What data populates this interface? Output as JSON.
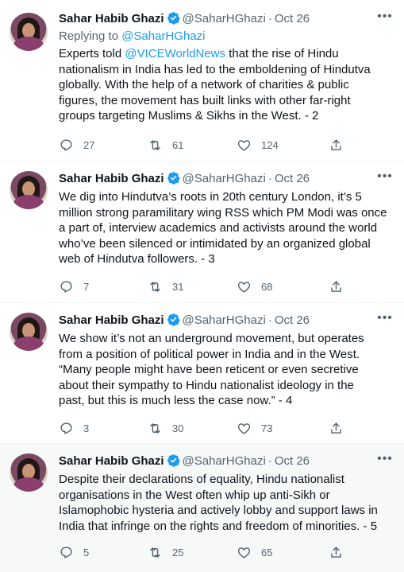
{
  "tweets": [
    {
      "name": "Sahar Habib Ghazi",
      "handle": "@SaharHGhazi",
      "separator": "·",
      "date": "Oct 26",
      "replying_label": "Replying to",
      "replying_handle": "@SaharHGhazi",
      "lines": [
        [
          "Experts told ",
          "@VICEWorldNews",
          " that the rise of Hindu"
        ],
        [
          "nationalism in India has led to the emboldening of Hindutva"
        ],
        [
          "globally. With the help of a network of charities & public"
        ],
        [
          "figures, the movement has built links with other far-right"
        ],
        [
          "groups targeting Muslims & Sikhs in the West. - 2"
        ]
      ],
      "replies": "27",
      "retweets": "61",
      "likes": "124"
    },
    {
      "name": "Sahar Habib Ghazi",
      "handle": "@SaharHGhazi",
      "separator": "·",
      "date": "Oct 26",
      "lines": [
        [
          "We dig into Hindutva’s roots in  20th century London, it’s 5"
        ],
        [
          "million strong paramilitary wing RSS which PM Modi was once"
        ],
        [
          "a part of, interview academics and activists around the world"
        ],
        [
          "who’ve been silenced or intimidated by an organized global"
        ],
        [
          "web of Hindutva followers. - 3"
        ]
      ],
      "replies": "7",
      "retweets": "31",
      "likes": "68"
    },
    {
      "name": "Sahar Habib Ghazi",
      "handle": "@SaharHGhazi",
      "separator": "·",
      "date": "Oct 26",
      "lines": [
        [
          "We show it’s not an underground movement, but operates"
        ],
        [
          "from a position of political power in India and in the West."
        ],
        [
          "“Many people might have been reticent or even secretive"
        ],
        [
          "about their sympathy to Hindu nationalist ideology in the"
        ],
        [
          "past, but this is much less the case now.” - 4"
        ]
      ],
      "replies": "3",
      "retweets": "30",
      "likes": "73"
    },
    {
      "name": "Sahar Habib Ghazi",
      "handle": "@SaharHGhazi",
      "separator": "·",
      "date": "Oct 26",
      "lines": [
        [
          "Despite their declarations of equality, Hindu nationalist"
        ],
        [
          "organisations in the West often whip up anti-Sikh or"
        ],
        [
          "Islamophobic hysteria and actively lobby and support laws in"
        ],
        [
          "India that infringe on the rights and freedom of minorities. - 5"
        ]
      ],
      "replies": "5",
      "retweets": "25",
      "likes": "65"
    }
  ],
  "colors": {
    "link": "#1d9bf0",
    "muted": "#536471",
    "text": "#0f1419",
    "highlight_bg": "#f7f9f9"
  },
  "icons": [
    "verified-badge-icon",
    "more-icon",
    "reply-icon",
    "retweet-icon",
    "like-icon",
    "share-icon"
  ]
}
